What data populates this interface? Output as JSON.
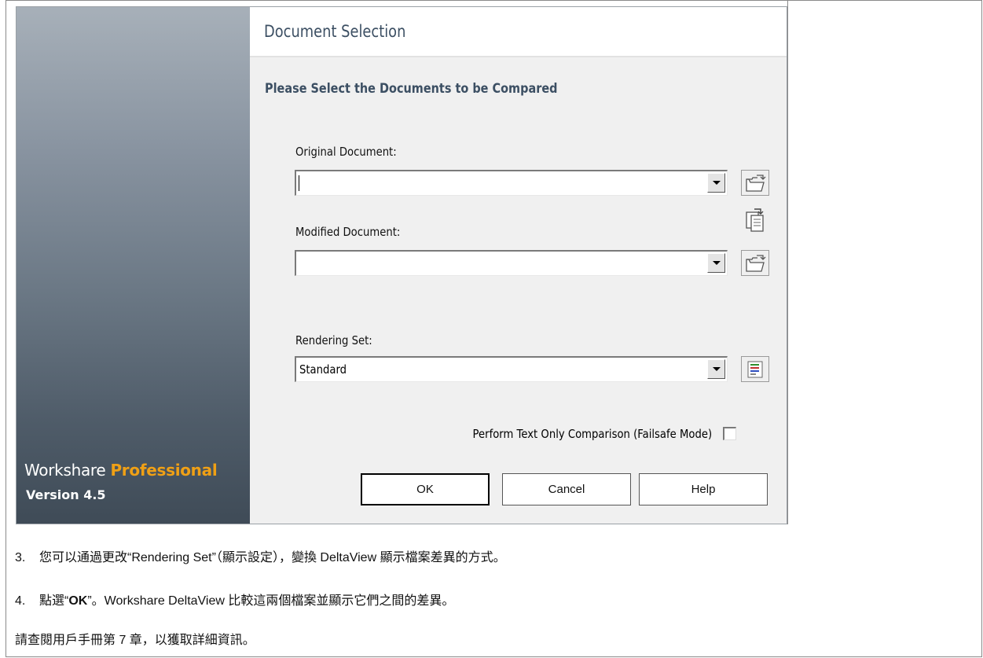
{
  "dialog": {
    "title": "Document Selection",
    "subtitle": "Please Select the Documents to be Compared",
    "original_label": "Original Document:",
    "original_value": "",
    "modified_label": "Modified Document:",
    "modified_value": "",
    "rendering_label": "Rendering Set:",
    "rendering_value": "Standard",
    "failsafe_label": "Perform Text Only Comparison (Failsafe Mode)",
    "failsafe_checked": false,
    "ok_label": "OK",
    "cancel_label": "Cancel",
    "help_label": "Help"
  },
  "brand": {
    "name_regular": "Workshare ",
    "name_accent": "Professional",
    "version": "Version 4.5",
    "accent_color": "#f0a015"
  },
  "doc": {
    "step3_num": "3.",
    "step3_text": "您可以通過更改“Rendering Set”（顯示設定），變換 DeltaView 顯示檔案差異的方式。",
    "step4_num": "4.",
    "step4_prefix": "點選“",
    "step4_bold": "OK",
    "step4_suffix": "”。Workshare DeltaView 比較這兩個檔案並顯示它們之間的差異。",
    "footer_text": "請查閱用戶手冊第 7 章，以獲取詳細資訊。"
  },
  "icons": {
    "browse_original": "open-folder-icon",
    "swap": "swap-documents-icon",
    "browse_modified": "open-folder-icon",
    "rendering_options": "rendering-options-icon"
  }
}
